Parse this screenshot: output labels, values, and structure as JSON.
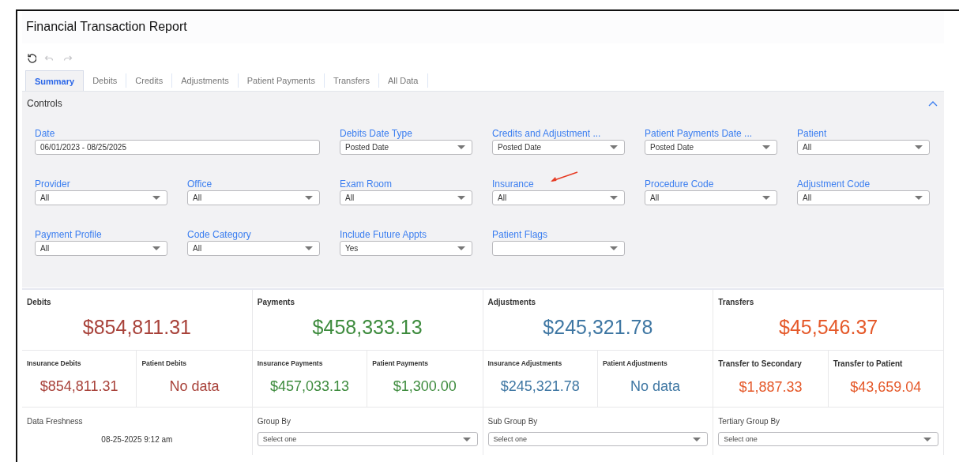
{
  "window": {
    "title": "Financial Transaction Report"
  },
  "toolbar": [
    {
      "kind": "refresh",
      "disabled": false
    },
    {
      "kind": "undo",
      "disabled": true
    },
    {
      "kind": "redo",
      "disabled": true
    }
  ],
  "tabs": [
    {
      "label": "Summary",
      "selected": true
    },
    {
      "label": "Debits",
      "selected": false
    },
    {
      "label": "Credits",
      "selected": false
    },
    {
      "label": "Adjustments",
      "selected": false
    },
    {
      "label": "Patient Payments",
      "selected": false
    },
    {
      "label": "Transfers",
      "selected": false
    },
    {
      "label": "All Data",
      "selected": false
    }
  ],
  "controls": {
    "title": "Controls",
    "expanded": true,
    "filters": [
      {
        "kind": "date",
        "label": "Date",
        "value": "06/01/2023 - 08/25/2025"
      },
      {
        "kind": "select",
        "label": "Debits Date Type",
        "value": "Posted Date"
      },
      {
        "kind": "select",
        "label": "Credits and Adjustment ...",
        "value": "Posted Date"
      },
      {
        "kind": "select",
        "label": "Patient Payments Date ...",
        "value": "Posted Date"
      },
      {
        "kind": "select",
        "label": "Patient",
        "value": "All"
      },
      {
        "kind": "select",
        "label": "Provider",
        "value": "All"
      },
      {
        "kind": "select",
        "label": "Office",
        "value": "All"
      },
      {
        "kind": "select",
        "label": "Exam Room",
        "value": "All"
      },
      {
        "kind": "select",
        "label": "Insurance",
        "value": "All",
        "annotated": true
      },
      {
        "kind": "select",
        "label": "Procedure Code",
        "value": "All"
      },
      {
        "kind": "select",
        "label": "Adjustment Code",
        "value": "All"
      },
      {
        "kind": "select",
        "label": "Payment Profile",
        "value": "All"
      },
      {
        "kind": "select",
        "label": "Code Category",
        "value": "All"
      },
      {
        "kind": "select",
        "label": "Include Future Appts",
        "value": "Yes"
      },
      {
        "kind": "select",
        "label": "Patient Flags"
      }
    ]
  },
  "summary": [
    {
      "title": "Debits",
      "total": "$854,811.31",
      "color": "#a8423a",
      "parts": [
        {
          "label": "Insurance Debits",
          "value": "$854,811.31"
        },
        {
          "label": "Patient Debits",
          "value": "No data"
        }
      ]
    },
    {
      "title": "Payments",
      "total": "$458,333.13",
      "color": "#3d8b3d",
      "parts": [
        {
          "label": "Insurance Payments",
          "value": "$457,033.13"
        },
        {
          "label": "Patient Payments",
          "value": "$1,300.00"
        }
      ]
    },
    {
      "title": "Adjustments",
      "total": "$245,321.78",
      "color": "#3f77a3",
      "parts": [
        {
          "label": "Insurance Adjustments",
          "value": "$245,321.78"
        },
        {
          "label": "Patient Adjustments",
          "value": "No data"
        }
      ]
    },
    {
      "title": "Transfers",
      "total": "$45,546.37",
      "color": "#e5592a",
      "large_labels": true,
      "parts": [
        {
          "label": "Transfer to Secondary",
          "value": "$1,887.33"
        },
        {
          "label": "Transfer to Patient",
          "value": "$43,659.04"
        }
      ]
    }
  ],
  "freshness": {
    "label": "Data Freshness",
    "value": "08-25-2025 9:12 am"
  },
  "grouping": [
    {
      "label": "Group By",
      "placeholder": "Select one"
    },
    {
      "label": "Sub Group By",
      "placeholder": "Select one"
    },
    {
      "label": "Tertiary Group By",
      "placeholder": "Select one"
    }
  ]
}
